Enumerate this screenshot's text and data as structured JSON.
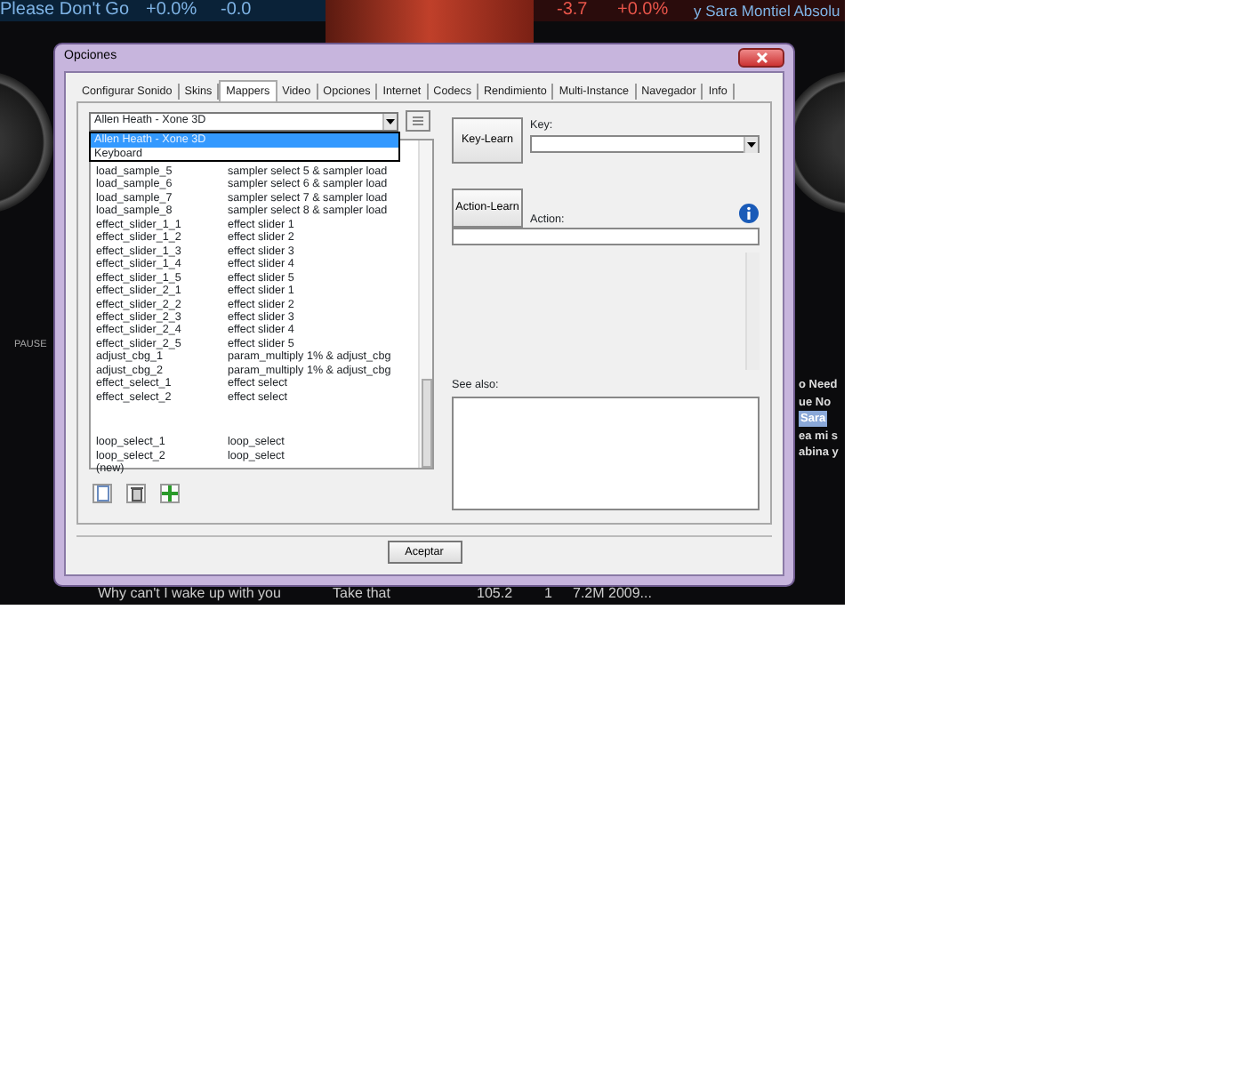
{
  "background_app": {
    "deck_left": {
      "title": "Please Don't Go",
      "pitch": "+0.0%",
      "gain": "-0.0"
    },
    "deck_right": {
      "gain": "-3.7",
      "pitch": "+0.0%",
      "title": "y Sara Montiel Absolu"
    },
    "pause_label": "PAUSE",
    "playlist_fragments": [
      {
        "text": "o Need",
        "selected": false
      },
      {
        "text": "ue No",
        "selected": false
      },
      {
        "text": "Sara",
        "selected": true
      },
      {
        "text": "ea mi s",
        "selected": false
      },
      {
        "text": "abina y",
        "selected": false
      }
    ],
    "track_row": {
      "title": "Why can't I wake up with you",
      "artist": "Take that",
      "bpm": "105.2",
      "column_4": "1",
      "column_5": "7.2M 2009..."
    }
  },
  "dialog": {
    "title": "Opciones",
    "tabs": [
      {
        "label": "Configurar Sonido",
        "selected": false
      },
      {
        "label": "Skins",
        "selected": false
      },
      {
        "label": "Mappers",
        "selected": true
      },
      {
        "label": "Video",
        "selected": false
      },
      {
        "label": "Opciones",
        "selected": false
      },
      {
        "label": "Internet",
        "selected": false
      },
      {
        "label": "Codecs",
        "selected": false
      },
      {
        "label": "Rendimiento",
        "selected": false
      },
      {
        "label": "Multi-Instance",
        "selected": false
      },
      {
        "label": "Navegador",
        "selected": false
      },
      {
        "label": "Info",
        "selected": false
      }
    ],
    "mapper_select": {
      "value": "Allen Heath - Xone 3D",
      "expanded": true,
      "options": [
        {
          "label": "Allen Heath - Xone 3D",
          "selected": true
        },
        {
          "label": "Keyboard",
          "selected": false
        }
      ]
    },
    "mappings": [
      {
        "key": "load_sample_5",
        "action": "sampler select 5 & sampler load",
        "gap_before": false
      },
      {
        "key": "load_sample_6",
        "action": "sampler select 6 & sampler load",
        "gap_before": false
      },
      {
        "key": "load_sample_7",
        "action": "sampler select 7 & sampler load",
        "gap_before": false
      },
      {
        "key": "load_sample_8",
        "action": "sampler select 8 & sampler load",
        "gap_before": false
      },
      {
        "key": "effect_slider_1_1",
        "action": "effect slider 1",
        "gap_before": false
      },
      {
        "key": "effect_slider_1_2",
        "action": "effect slider 2",
        "gap_before": false
      },
      {
        "key": "effect_slider_1_3",
        "action": "effect slider 3",
        "gap_before": false
      },
      {
        "key": "effect_slider_1_4",
        "action": "effect slider 4",
        "gap_before": false
      },
      {
        "key": "effect_slider_1_5",
        "action": "effect slider 5",
        "gap_before": false
      },
      {
        "key": "effect_slider_2_1",
        "action": "effect slider 1",
        "gap_before": false
      },
      {
        "key": "effect_slider_2_2",
        "action": "effect slider 2",
        "gap_before": false
      },
      {
        "key": "effect_slider_2_3",
        "action": "effect slider 3",
        "gap_before": false
      },
      {
        "key": "effect_slider_2_4",
        "action": "effect slider 4",
        "gap_before": false
      },
      {
        "key": "effect_slider_2_5",
        "action": "effect slider 5",
        "gap_before": false
      },
      {
        "key": "adjust_cbg_1",
        "action": "param_multiply 1% & adjust_cbg",
        "gap_before": false
      },
      {
        "key": "adjust_cbg_2",
        "action": "param_multiply 1% & adjust_cbg",
        "gap_before": false
      },
      {
        "key": "effect_select_1",
        "action": "effect select",
        "gap_before": false
      },
      {
        "key": "effect_select_2",
        "action": "effect select",
        "gap_before": false
      },
      {
        "key": "loop_select_1",
        "action": "loop_select",
        "gap_before": true
      },
      {
        "key": "loop_select_2",
        "action": "loop_select",
        "gap_before": false
      }
    ],
    "new_entry": "(new)",
    "key_learn_button": "Key-Learn",
    "key_label": "Key:",
    "action_learn_button": "Action-Learn",
    "action_label": "Action:",
    "see_also_label": "See also:",
    "ok_button": "Aceptar"
  }
}
